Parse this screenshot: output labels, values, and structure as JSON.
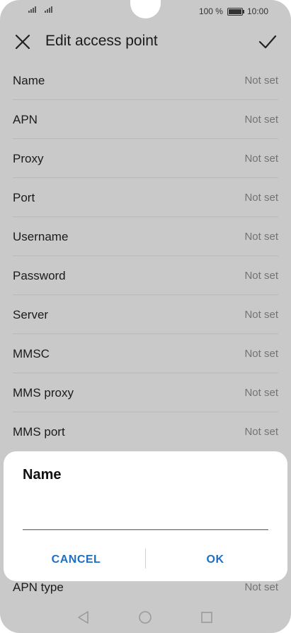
{
  "status_bar": {
    "battery_text": "100 %",
    "time": "10:00",
    "battery_level": 1.0
  },
  "toolbar": {
    "title": "Edit access point",
    "close_icon": "close-icon",
    "confirm_icon": "check-icon"
  },
  "fields": [
    {
      "label": "Name",
      "value": "Not set"
    },
    {
      "label": "APN",
      "value": "Not set"
    },
    {
      "label": "Proxy",
      "value": "Not set"
    },
    {
      "label": "Port",
      "value": "Not set"
    },
    {
      "label": "Username",
      "value": "Not set"
    },
    {
      "label": "Password",
      "value": "Not set"
    },
    {
      "label": "Server",
      "value": "Not set"
    },
    {
      "label": "MMSC",
      "value": "Not set"
    },
    {
      "label": "MMS proxy",
      "value": "Not set"
    },
    {
      "label": "MMS port",
      "value": "Not set"
    }
  ],
  "partial_row": {
    "label": "APN type",
    "value": "Not set"
  },
  "dialog": {
    "title": "Name",
    "input_value": "",
    "cancel_label": "CANCEL",
    "ok_label": "OK"
  },
  "colors": {
    "accent": "#1e6ec2",
    "scrim_background": "#c9c9c9"
  },
  "nav": {
    "back_icon": "back-triangle-icon",
    "home_icon": "home-circle-icon",
    "recents_icon": "recents-square-icon"
  }
}
